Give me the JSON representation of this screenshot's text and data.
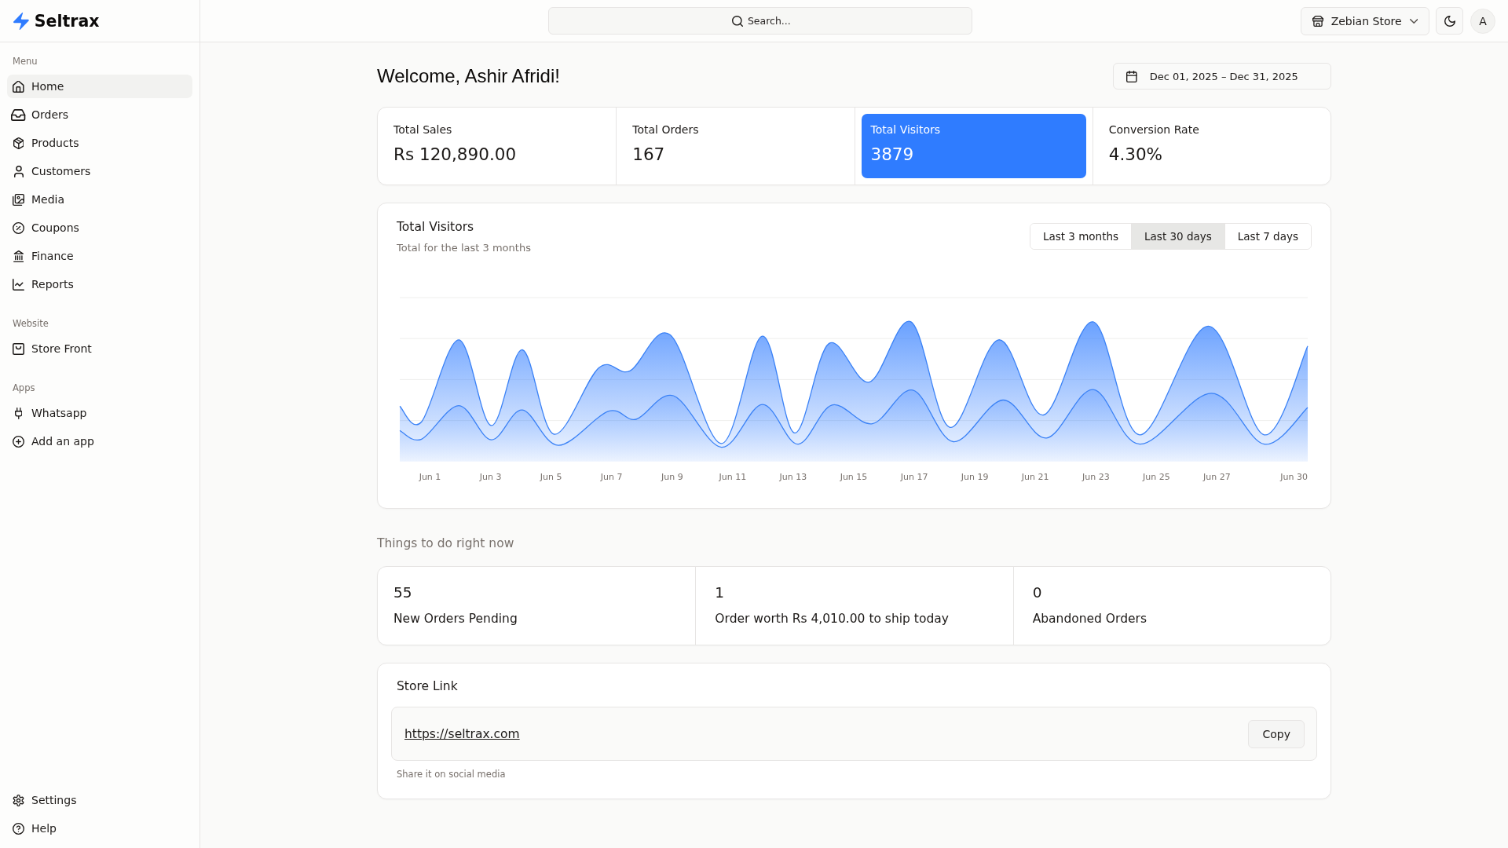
{
  "sidebar": {
    "logo": {
      "text": "Seltrax"
    },
    "sections": [
      {
        "title": "Menu",
        "items": [
          {
            "label": "Home",
            "selected": true
          },
          {
            "label": "Orders",
            "selected": false
          },
          {
            "label": "Products",
            "selected": false
          },
          {
            "label": "Customers",
            "selected": false
          },
          {
            "label": "Media",
            "selected": false
          },
          {
            "label": "Coupons",
            "selected": false
          },
          {
            "label": "Finance",
            "selected": false
          },
          {
            "label": "Reports",
            "selected": false
          }
        ]
      },
      {
        "title": "Website",
        "items": [
          {
            "label": "Store Front",
            "selected": false
          }
        ]
      },
      {
        "title": "Apps",
        "items": [
          {
            "label": "Whatsapp",
            "selected": false
          },
          {
            "label": "Add an app",
            "selected": false
          }
        ]
      }
    ],
    "footer_items": [
      {
        "label": "Settings",
        "selected": false
      },
      {
        "label": "Help",
        "selected": false
      }
    ]
  },
  "topbar": {
    "search": {
      "placeholder": "Search..."
    },
    "store_selector": {
      "label": "Zebian Store"
    },
    "avatar": {
      "initial": "A"
    }
  },
  "header": {
    "title": "Welcome, Ashir Afridi!",
    "date_range": "Dec 01, 2025 – Dec 31, 2025"
  },
  "stats": [
    {
      "label": "Total Sales",
      "value": "Rs 120,890.00",
      "selected": false
    },
    {
      "label": "Total Orders",
      "value": "167",
      "selected": false
    },
    {
      "label": "Total Visitors",
      "value": "3879",
      "selected": true
    },
    {
      "label": "Conversion Rate",
      "value": "4.30%",
      "selected": false
    }
  ],
  "chart_card": {
    "title": "Total Visitors",
    "subtitle": "Total for the last 3 months",
    "ranges": [
      {
        "label": "Last 3 months",
        "selected": false
      },
      {
        "label": "Last 30 days",
        "selected": true
      },
      {
        "label": "Last 7 days",
        "selected": false
      }
    ],
    "x_axis_labels": [
      "Jun 1",
      "Jun 3",
      "Jun 5",
      "Jun 7",
      "Jun 9",
      "Jun 11",
      "Jun 13",
      "Jun 15",
      "Jun 17",
      "Jun 19",
      "Jun 21",
      "Jun 23",
      "Jun 25",
      "Jun 27",
      "Jun 30"
    ]
  },
  "tasks": {
    "heading": "Things to do right now",
    "items": [
      {
        "count": "55",
        "label": "New Orders Pending"
      },
      {
        "count": "1",
        "label": "Order worth Rs 4,010.00 to ship today"
      },
      {
        "count": "0",
        "label": "Abandoned Orders"
      }
    ]
  },
  "store_link": {
    "title": "Store Link",
    "url": "https://seltrax.com",
    "copy_button": "Copy",
    "hint": "Share it on social media"
  }
}
